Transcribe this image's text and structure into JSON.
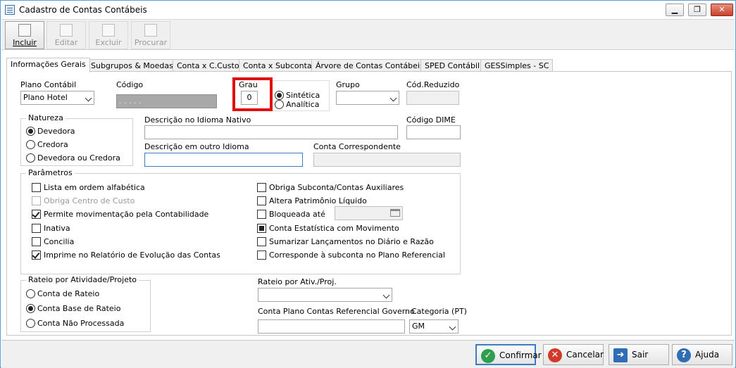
{
  "window": {
    "title": "Cadastro de Contas Contábeis",
    "minimize": "▁",
    "restore": "❐",
    "close": "✕"
  },
  "toolbar": [
    {
      "label": "Incluir",
      "state": "active"
    },
    {
      "label": "Editar",
      "state": "disabled"
    },
    {
      "label": "Excluir",
      "state": "disabled"
    },
    {
      "label": "Procurar",
      "state": "disabled"
    }
  ],
  "tabs": [
    "Informações Gerais",
    "Subgrupos & Moedas",
    "Conta x C.Custo",
    "Conta x Subconta",
    "Árvore de Contas Contábeis",
    "SPED Contábil",
    "GESSimples - SC"
  ],
  "form": {
    "plano_label": "Plano Contábil",
    "plano_value": "Plano Hotel",
    "codigo_label": "Código",
    "codigo_value": ". . . . .",
    "grau_label": "Grau",
    "grau_value": "0",
    "sintetica": "Sintética",
    "analitica": "Analítica",
    "grupo_label": "Grupo",
    "grupo_value": "",
    "codred_label": "Cód.Reduzido",
    "codred_value": "",
    "natureza_title": "Natureza",
    "natureza_options": [
      "Devedora",
      "Credora",
      "Devedora ou Credora"
    ],
    "desc_nativo_label": "Descrição no Idioma Nativo",
    "desc_nativo_value": "",
    "cod_dime_label": "Código DIME",
    "cod_dime_value": "",
    "desc_outro_label": "Descrição em outro Idioma",
    "desc_outro_value": "",
    "conta_corr_label": "Conta Correspondente",
    "conta_corr_value": "",
    "parametros_title": "Parâmetros",
    "params_left": [
      {
        "label": "Lista em ordem alfabética",
        "state": "off"
      },
      {
        "label": "Obriga Centro de Custo",
        "state": "disabled"
      },
      {
        "label": "Permite movimentação pela Contabilidade",
        "state": "on"
      },
      {
        "label": "Inativa",
        "state": "off"
      },
      {
        "label": "Concilia",
        "state": "off"
      },
      {
        "label": "Imprime no Relatório de Evolução das Contas",
        "state": "on"
      }
    ],
    "params_right": [
      {
        "label": "Obriga Subconta/Contas Auxiliares",
        "state": "off"
      },
      {
        "label": "Altera Patrimônio Líquido",
        "state": "off"
      },
      {
        "label": "Bloqueada até",
        "state": "off"
      },
      {
        "label": "Conta Estatística com Movimento",
        "state": "fill"
      },
      {
        "label": "Sumarizar Lançamentos no Diário e Razão",
        "state": "off"
      },
      {
        "label": "Corresponde à subconta no Plano Referencial",
        "state": "off"
      }
    ],
    "bloqueada_value": "",
    "rateio_title": "Rateio por Atividade/Projeto",
    "rateio_options": [
      "Conta de Rateio",
      "Conta Base de Rateio",
      "Conta Não Processada"
    ],
    "rateio_ativ_label": "Rateio por Ativ./Proj.",
    "rateio_ativ_value": "",
    "ref_gov_label": "Conta Plano Contas Referencial Governo",
    "ref_gov_value": "",
    "categoria_label": "Categoria (PT)",
    "categoria_value": "GM"
  },
  "footer": [
    {
      "label": "Confirmar",
      "icon": "✓",
      "color": "#2e9e4f"
    },
    {
      "label": "Cancelar",
      "icon": "✕",
      "color": "#d03a2a"
    },
    {
      "label": "Sair",
      "icon": "➜",
      "color": "#2f6db5"
    },
    {
      "label": "Ajuda",
      "icon": "?",
      "color": "#2f6db5"
    }
  ]
}
